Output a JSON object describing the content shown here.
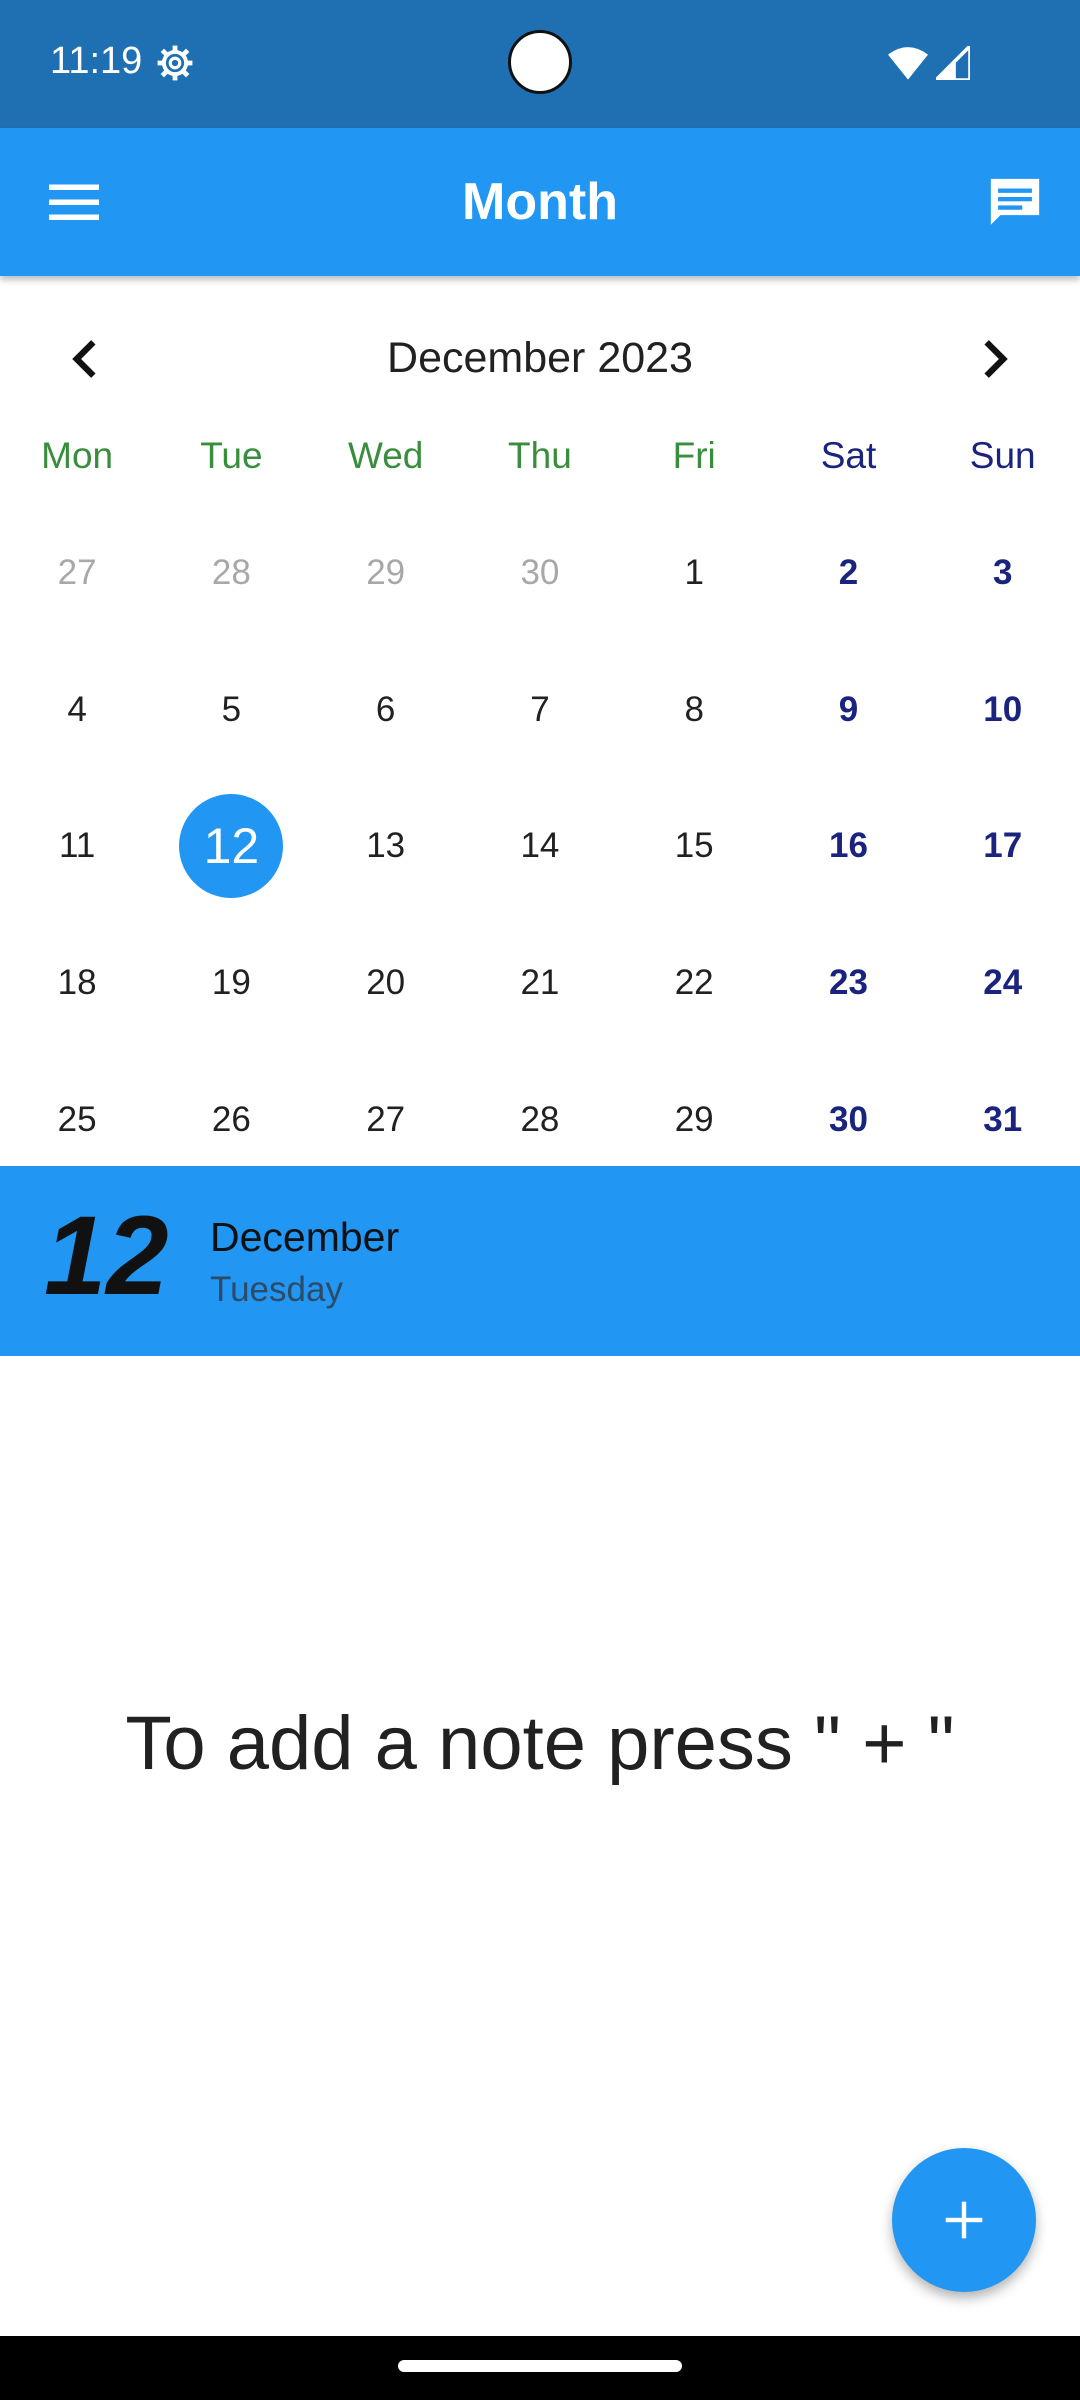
{
  "status_bar": {
    "time": "11:19",
    "icons": [
      "settings-gear-icon",
      "wifi-icon",
      "cellular-signal-icon"
    ]
  },
  "app_bar": {
    "title": "Month",
    "menu_icon": "hamburger-menu-icon",
    "action_icon": "chat-message-icon",
    "color": "#2196f3"
  },
  "calendar": {
    "month_label": "December 2023",
    "weekdays": [
      "Mon",
      "Tue",
      "Wed",
      "Thu",
      "Fri",
      "Sat",
      "Sun"
    ],
    "weeks": [
      [
        "27",
        "28",
        "29",
        "30",
        "1",
        "2",
        "3"
      ],
      [
        "4",
        "5",
        "6",
        "7",
        "8",
        "9",
        "10"
      ],
      [
        "11",
        "12",
        "13",
        "14",
        "15",
        "16",
        "17"
      ],
      [
        "18",
        "19",
        "20",
        "21",
        "22",
        "23",
        "24"
      ],
      [
        "25",
        "26",
        "27",
        "28",
        "29",
        "30",
        "31"
      ]
    ],
    "other_month_days_first_week": 4,
    "selected_day": "12",
    "weekday_color": "#388e3c",
    "weekend_color": "#1a237e"
  },
  "selected_date": {
    "day": "12",
    "month": "December",
    "weekday": "Tuesday"
  },
  "empty_state": {
    "message": "To add a note press \" + \""
  },
  "fab": {
    "icon": "plus-icon"
  }
}
